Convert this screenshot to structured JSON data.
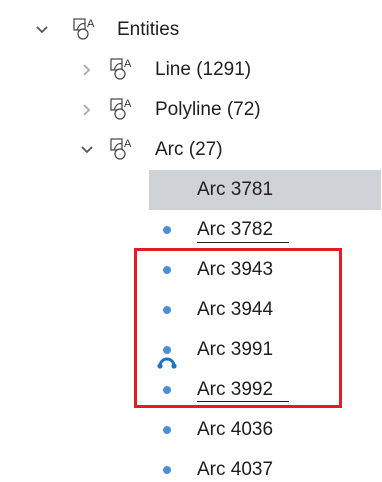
{
  "tree": {
    "root": {
      "label": "Entities",
      "expanded": true,
      "icon": "entity-group-icon"
    },
    "groups": [
      {
        "label": "Line (1291)",
        "expanded": false,
        "icon": "entity-group-icon"
      },
      {
        "label": "Polyline (72)",
        "expanded": false,
        "icon": "entity-group-icon"
      },
      {
        "label": "Arc (27)",
        "expanded": true,
        "icon": "entity-group-icon"
      }
    ],
    "arc_items": [
      {
        "label": "Arc 3781",
        "selected": true,
        "icon": "arc-link-icon"
      },
      {
        "label": "Arc 3782",
        "selected": false,
        "icon": "dot-icon"
      },
      {
        "label": "Arc 3943",
        "selected": false,
        "icon": "dot-icon"
      },
      {
        "label": "Arc 3944",
        "selected": false,
        "icon": "dot-icon"
      },
      {
        "label": "Arc 3991",
        "selected": false,
        "icon": "dot-icon"
      },
      {
        "label": "Arc 3992",
        "selected": false,
        "icon": "dot-icon"
      },
      {
        "label": "Arc 4036",
        "selected": false,
        "icon": "dot-icon"
      },
      {
        "label": "Arc 4037",
        "selected": false,
        "icon": "dot-icon"
      }
    ]
  },
  "colors": {
    "selection_bg": "#cfd3d8",
    "dot": "#4d8fd6",
    "highlight_box": "#e21b24",
    "arc_link_icon": "#1e73c9"
  }
}
